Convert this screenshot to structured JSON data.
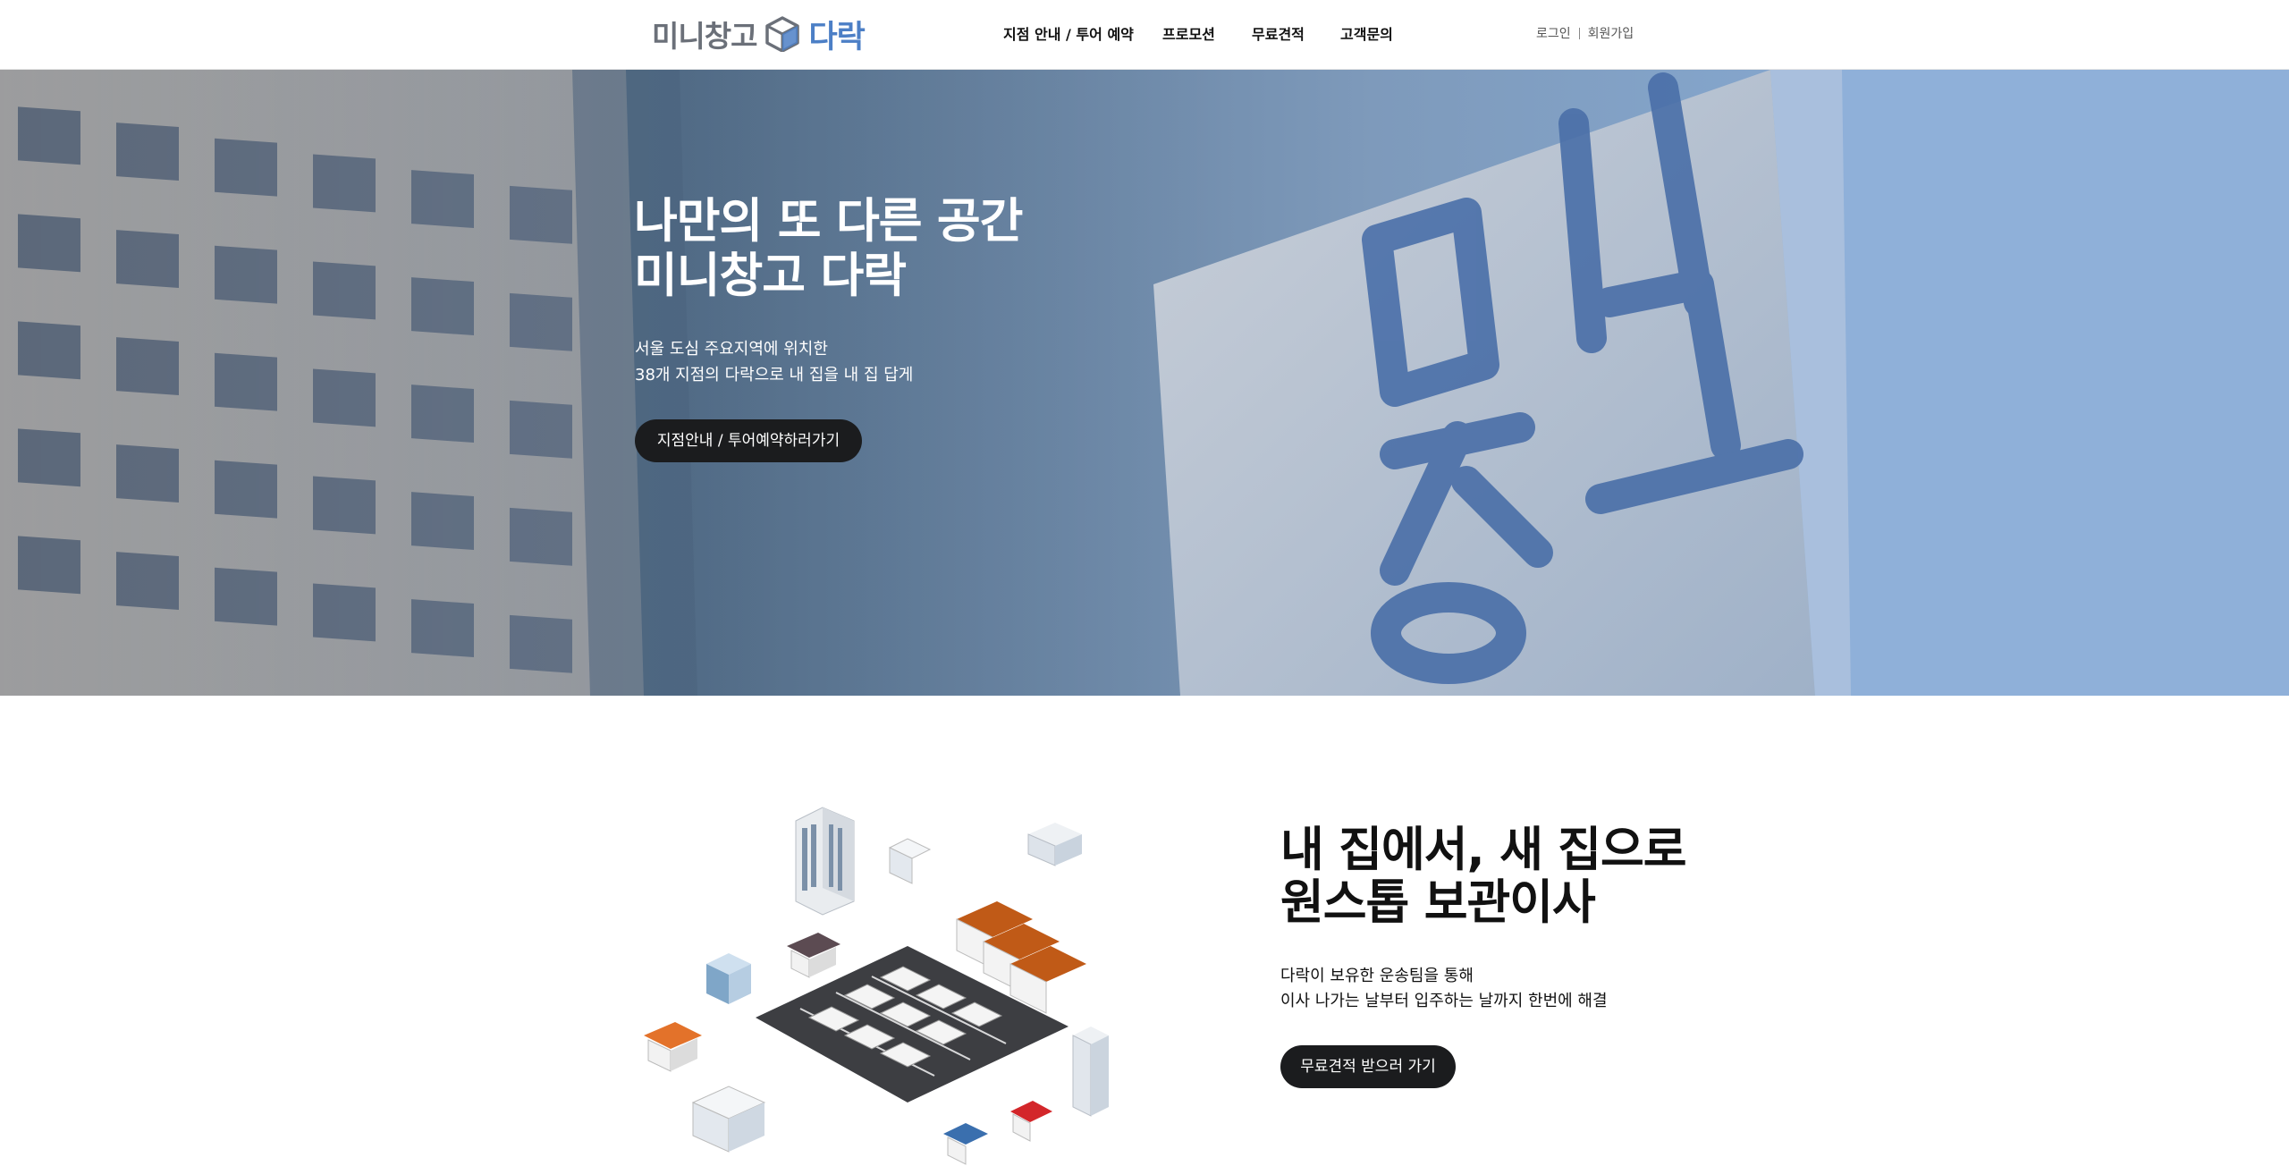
{
  "header": {
    "logo": {
      "text_a": "미니창고",
      "text_b": "다락"
    },
    "nav": [
      {
        "label": "지점 안내 / 투어 예약"
      },
      {
        "label": "프로모션"
      },
      {
        "label": "무료견적"
      },
      {
        "label": "고객문의"
      }
    ],
    "login_label": "로그인",
    "signup_label": "회원가입"
  },
  "hero": {
    "title_line1": "나만의 또 다른 공간",
    "title_line2": "미니창고 다락",
    "sub_line1": "서울 도심 주요지역에 위치한",
    "sub_line2": "38개 지점의 다락으로 내 집을 내 집 답게",
    "button_label": "지점안내 / 투어예약하러가기",
    "sign_text": "미니창고"
  },
  "section2": {
    "title_line1": "내 집에서, 새 집으로",
    "title_line2": "원스톱 보관이사",
    "sub_line1": "다락이 보유한 운송팀을 통해",
    "sub_line2": "이사 나가는 날부터 입주하는 날까지 한번에 해결",
    "button_label": "무료견적 받으러 가기"
  },
  "colors": {
    "brand_blue": "#4c7fc6",
    "logo_gray": "#6b7079",
    "button_dark": "#1b1c1e"
  }
}
